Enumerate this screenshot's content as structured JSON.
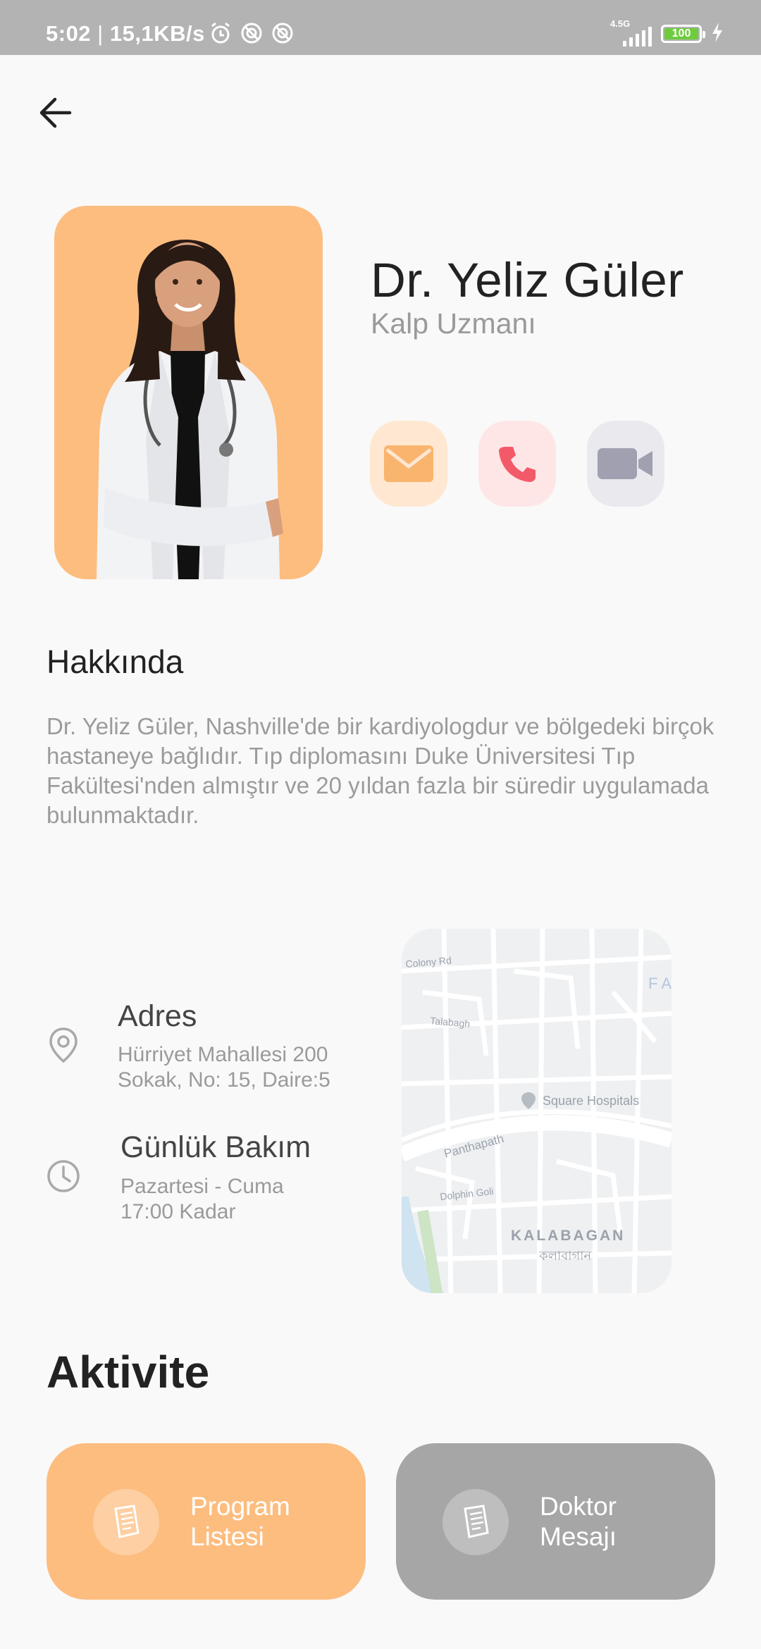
{
  "status_bar": {
    "time": "5:02",
    "speed": "15,1KB/s",
    "network": "4.5G",
    "battery": "100"
  },
  "doctor": {
    "name": "Dr. Yeliz Güler",
    "specialty": "Kalp Uzmanı"
  },
  "contact": {
    "email_icon": "envelope-icon",
    "call_icon": "phone-icon",
    "video_icon": "video-camera-icon",
    "email_color": "#f9b46e",
    "call_color": "#f25a6a",
    "video_color": "#a0a0b0"
  },
  "about": {
    "heading": "Hakkında",
    "text": "Dr. Yeliz Güler, Nashville'de bir kardiyologdur ve bölgedeki birçok hastaneye bağlıdır. Tıp diplomasını Duke Üniversitesi Tıp Fakültesi'nden almıştır ve 20 yıldan fazla bir süredir uygulamada bulunmaktadır."
  },
  "address": {
    "title": "Adres",
    "line1": "Hürriyet Mahallesi 200",
    "line2": "Sokak, No: 15, Daire:5"
  },
  "care": {
    "title": "Günlük Bakım",
    "line1": "Pazartesi - Cuma",
    "line2": "17:00 Kadar"
  },
  "map": {
    "labels": [
      "Colony Rd",
      "Talabagh",
      "Square Hospitals",
      "Panthapath",
      "Dolphin Goli",
      "KALABAGAN",
      "কলাবাগান",
      "F A"
    ]
  },
  "activity": {
    "heading": "Aktivite",
    "cards": [
      {
        "line1": "Program",
        "line2": "Listesi",
        "color": "#fdbd7f"
      },
      {
        "line1": "Doktor",
        "line2": "Mesajı",
        "color": "#a6a6a6"
      }
    ]
  }
}
